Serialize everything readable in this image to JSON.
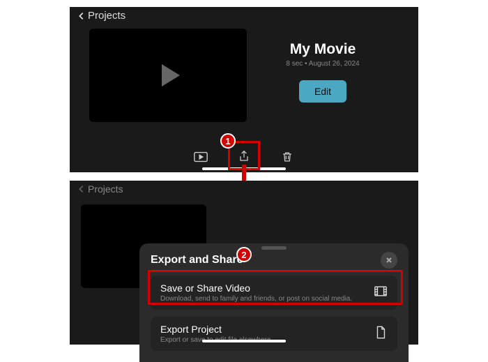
{
  "header": {
    "back_label": "Projects"
  },
  "project": {
    "title": "My Movie",
    "duration": "8 sec",
    "date": "August 26, 2024",
    "edit_label": "Edit"
  },
  "annotations": {
    "step1": "1",
    "step2": "2"
  },
  "sheet": {
    "title": "Export and Share",
    "options": [
      {
        "title": "Save or Share Video",
        "subtitle": "Download, send to family and friends, or post on social media."
      },
      {
        "title": "Export Project",
        "subtitle": "Export or save to edit file elsewhere."
      }
    ]
  }
}
